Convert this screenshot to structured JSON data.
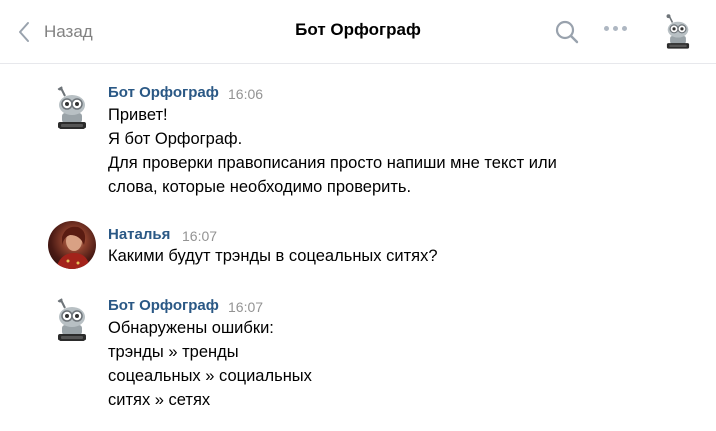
{
  "header": {
    "back_label": "Назад",
    "title": "Бот Орфограф",
    "icons": {
      "back": "chevron-left-icon",
      "search": "search-icon",
      "more": "more-dots-icon"
    }
  },
  "messages": [
    {
      "author": "Бот Орфограф",
      "time": "16:06",
      "avatar": "robot-avatar",
      "lines": [
        "Привет!",
        "Я бот Орфограф.",
        "Для проверки правописания просто напиши мне текст или",
        "слова, которые необходимо проверить."
      ]
    },
    {
      "author": "Наталья",
      "time": "16:07",
      "avatar": "user-photo-avatar",
      "lines": [
        "Какими будут трэнды в соцеальных ситях?"
      ]
    },
    {
      "author": "Бот Орфограф",
      "time": "16:07",
      "avatar": "robot-avatar",
      "lines": [
        "Обнаружены ошибки:",
        "трэнды » тренды",
        "соцеальных » социальных",
        "ситях » сетях"
      ]
    }
  ],
  "colors": {
    "author_link": "#2a5885",
    "muted": "#828282",
    "divider": "#e7e8ec"
  }
}
